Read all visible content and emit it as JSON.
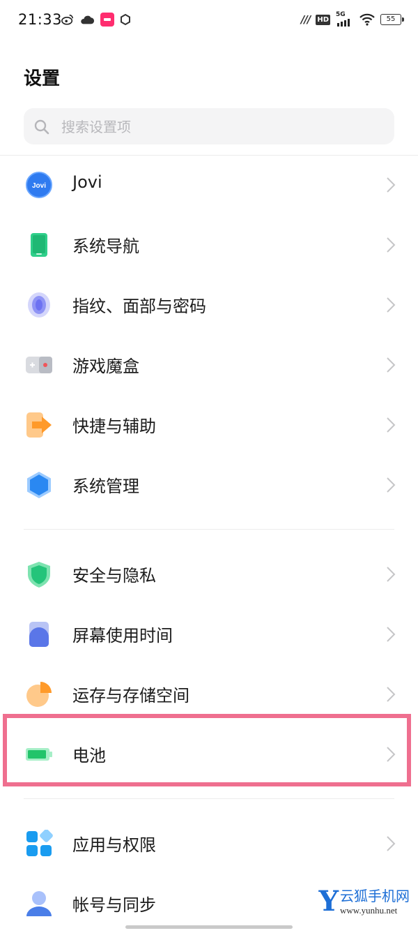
{
  "status_bar": {
    "time": "21:33",
    "battery": "55",
    "signal_label": "5G",
    "hd_label": "HD"
  },
  "page": {
    "title": "设置"
  },
  "search": {
    "placeholder": "搜索设置项",
    "value": ""
  },
  "groups": [
    {
      "items": [
        {
          "label": "Jovi",
          "icon": "jovi-icon",
          "icon_text": "Jovi",
          "color": "#2f7bf0"
        },
        {
          "label": "系统导航",
          "icon": "phone-navigation-icon",
          "color": "#2fcf8a"
        },
        {
          "label": "指纹、面部与密码",
          "icon": "fingerprint-icon",
          "color": "#6d72f2"
        },
        {
          "label": "游戏魔盒",
          "icon": "gamepad-icon",
          "color": "#b9bcc4"
        },
        {
          "label": "快捷与辅助",
          "icon": "shortcut-arrow-icon",
          "color": "#ff9a2a"
        },
        {
          "label": "系统管理",
          "icon": "hexagon-icon",
          "color": "#2a88f2"
        }
      ]
    },
    {
      "items": [
        {
          "label": "安全与隐私",
          "icon": "shield-icon",
          "color": "#24c47a"
        },
        {
          "label": "屏幕使用时间",
          "icon": "screen-time-icon",
          "color": "#5a76e8"
        },
        {
          "label": "运存与存储空间",
          "icon": "pie-storage-icon",
          "color": "#ff9a2a"
        },
        {
          "label": "电池",
          "icon": "battery-icon",
          "color": "#22c46a",
          "highlighted": true
        }
      ]
    },
    {
      "items": [
        {
          "label": "应用与权限",
          "icon": "apps-grid-icon",
          "color": "#1a9cf0"
        },
        {
          "label": "帐号与同步",
          "icon": "account-icon",
          "color": "#4a7ee8"
        }
      ]
    }
  ],
  "watermark": {
    "brand": "云狐手机网",
    "url": "www.yunhu.net",
    "letter": "Y"
  }
}
